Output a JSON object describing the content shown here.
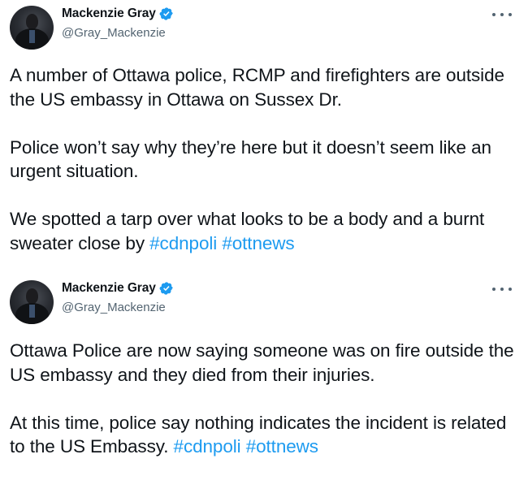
{
  "tweets": [
    {
      "author": {
        "name": "Mackenzie Gray",
        "handle": "@Gray_Mackenzie",
        "verified": true
      },
      "menu_icon": "more-horizontal-icon",
      "paragraphs": [
        {
          "text": "A number of Ottawa police, RCMP and firefighters are outside the US embassy in Ottawa on Sussex Dr.",
          "hashtags": []
        },
        {
          "text": "Police won’t say why they’re here but it doesn’t seem like an urgent situation.",
          "hashtags": []
        },
        {
          "text": "We spotted a tarp over what looks to be a body and a burnt sweater close by",
          "hashtags": [
            "#cdnpoli",
            "#ottnews"
          ]
        }
      ]
    },
    {
      "author": {
        "name": "Mackenzie Gray",
        "handle": "@Gray_Mackenzie",
        "verified": true
      },
      "menu_icon": "more-horizontal-icon",
      "paragraphs": [
        {
          "text": "Ottawa Police are now saying someone was on fire outside the US embassy and they died from their injuries.",
          "hashtags": []
        },
        {
          "text": "At this time, police say nothing indicates the incident is related to the US Embassy.",
          "hashtags": [
            "#cdnpoli",
            "#ottnews"
          ]
        }
      ]
    }
  ],
  "colors": {
    "text": "#0f1419",
    "secondary": "#536471",
    "link": "#1d9bf0",
    "verified": "#1d9bf0",
    "background": "#ffffff"
  }
}
